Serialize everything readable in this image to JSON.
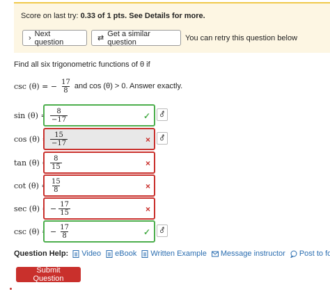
{
  "banner": {
    "score_prefix": "Score on last try: ",
    "score_value": "0.33 of 1 pts",
    "score_suffix": ". See Details for more.",
    "next_label": "Next question",
    "similar_label": "Get a similar question",
    "retry_note": "You can retry this question below"
  },
  "question": {
    "prompt_text": "Find all six trigonometric functions of θ if",
    "given_lhs": "csc (θ) = −",
    "given_num": "17",
    "given_den": "8",
    "given_rest": " and cos (θ) > 0. Answer exactly."
  },
  "answers": [
    {
      "label": "sin (θ) =",
      "negative": false,
      "num": "8",
      "den": "−17",
      "status": "correct"
    },
    {
      "label": "cos (θ) =",
      "negative": false,
      "num": "15",
      "den": "−17",
      "status": "incorrect"
    },
    {
      "label": "tan (θ) =",
      "negative": false,
      "num": "8",
      "den": "15",
      "status": "incorrect"
    },
    {
      "label": "cot (θ) =",
      "negative": false,
      "num": "15",
      "den": "8",
      "status": "incorrect"
    },
    {
      "label": "sec (θ) =",
      "negative": true,
      "num": "17",
      "den": "15",
      "status": "incorrect"
    },
    {
      "label": "csc (θ) =",
      "negative": true,
      "num": "17",
      "den": "8",
      "status": "correct"
    }
  ],
  "help": {
    "label": "Question Help:",
    "video": "Video",
    "ebook": "eBook",
    "example": "Written Example",
    "message": "Message instructor",
    "forum": "Post to forum"
  },
  "submit_label": "Submit Question",
  "icons": {
    "check": "✓",
    "cross": "×",
    "next": "›",
    "similar": "⇄",
    "key": "⚦"
  },
  "colors": {
    "banner_bg": "#fdf6e3",
    "correct": "#4cae4c",
    "incorrect": "#c9302c",
    "link": "#2a6db0",
    "submit_bg": "#c9302c"
  }
}
